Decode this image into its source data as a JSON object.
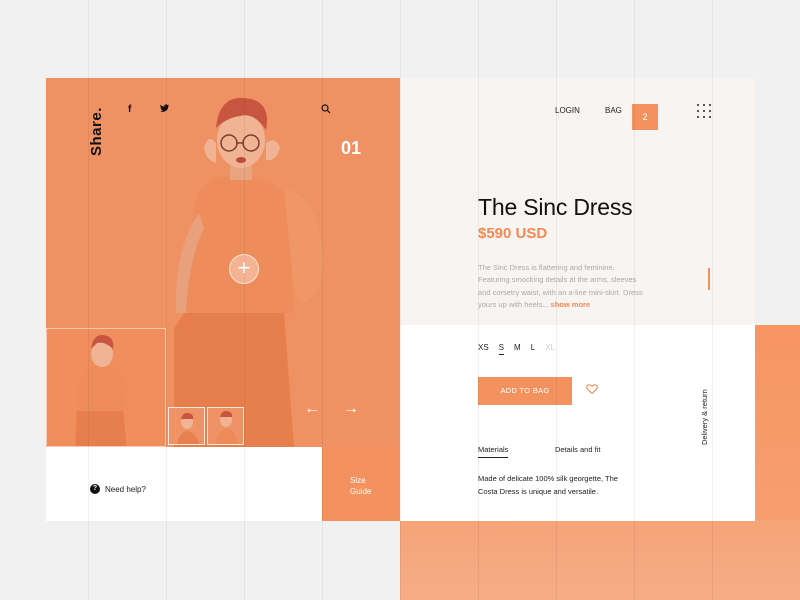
{
  "brand": "Share.",
  "social": {
    "facebook": "f",
    "twitter": "t"
  },
  "hero": {
    "slide_number": "01",
    "prev_arrow": "←",
    "next_arrow": "→",
    "plus": "+"
  },
  "help": {
    "icon": "?",
    "label": "Need help?"
  },
  "size_guide": {
    "line1": "Size",
    "line2": "Guide"
  },
  "nav": {
    "login": "LOGIN",
    "bag": "BAG",
    "bag_count": "2"
  },
  "product": {
    "title": "The Sinc Dress",
    "price": "$590 USD",
    "description": "The Sinc Dress is flattering and feminine. Featuring smocking details at the arms, sleeves and corsetry waist, with an a-line mini-skirt. Dress yours up with heels...",
    "show_more": "show more",
    "sizes": [
      "XS",
      "S",
      "M",
      "L",
      "XL"
    ],
    "selected_size": "S",
    "add_to_bag": "ADD TO BAG",
    "delivery": "Delivery & return"
  },
  "tabs": {
    "materials": "Materials",
    "details": "Details and fit"
  },
  "materials_text": "Made of delicate 100% silk georgette, The Costa Dress is unique and versatile.",
  "colors": {
    "accent": "#f4925f",
    "hero_bg": "#ef9162",
    "panel_bg": "#f8f4f1"
  }
}
